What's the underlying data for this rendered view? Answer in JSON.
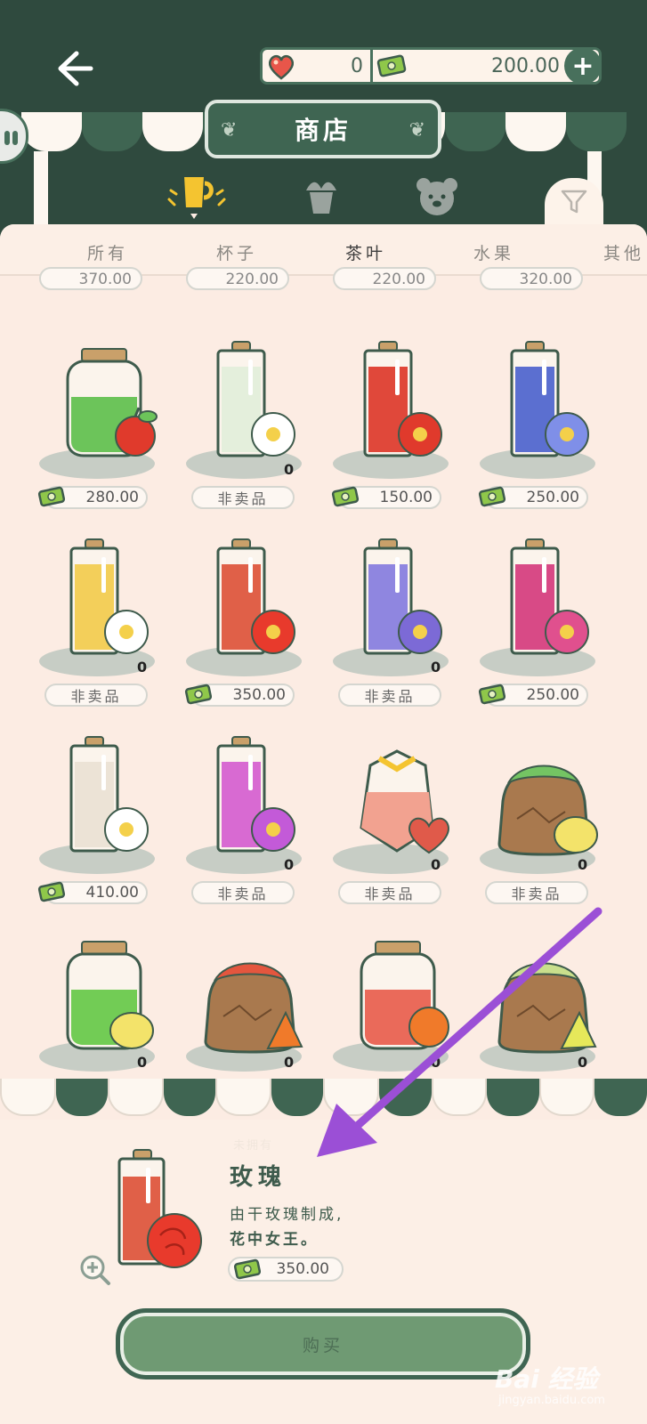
{
  "wallet": {
    "hearts": "0",
    "money": "200.00",
    "add": "+"
  },
  "title": "商店",
  "tabs": [
    "所有",
    "杯子",
    "茶叶",
    "水果",
    "其他"
  ],
  "active_tab": "茶叶",
  "partial_prices": [
    "370.00",
    "220.00",
    "220.00",
    "320.00"
  ],
  "items": [
    {
      "name": "jar-mint-apple",
      "price": "280.00",
      "sale": true,
      "count": "",
      "art": "jar",
      "liquid": "#6cc45a",
      "flower": "apple"
    },
    {
      "name": "tube-jasmine",
      "price": "非卖品",
      "sale": false,
      "count": "0",
      "art": "tube",
      "liquid": "#e4efdc",
      "flower": "#ffffff"
    },
    {
      "name": "tube-hibiscus",
      "price": "150.00",
      "sale": true,
      "count": "",
      "art": "tube",
      "liquid": "#e0483a",
      "flower": "#e03a2c"
    },
    {
      "name": "tube-blue-flower",
      "price": "250.00",
      "sale": true,
      "count": "",
      "art": "tube",
      "liquid": "#5b6fd0",
      "flower": "#7f8fe8"
    },
    {
      "name": "tube-chamomile",
      "price": "非卖品",
      "sale": false,
      "count": "0",
      "art": "tube",
      "liquid": "#f3cf5a",
      "flower": "#ffffff"
    },
    {
      "name": "tube-rose",
      "price": "350.00",
      "sale": true,
      "count": "",
      "art": "tube",
      "liquid": "#e06048",
      "flower": "#e83a2c"
    },
    {
      "name": "tube-lavender",
      "price": "非卖品",
      "sale": false,
      "count": "0",
      "art": "tube",
      "liquid": "#8f86e0",
      "flower": "#7c6ad6"
    },
    {
      "name": "tube-pink-flower",
      "price": "250.00",
      "sale": true,
      "count": "",
      "art": "tube",
      "liquid": "#d84a86",
      "flower": "#e0508e"
    },
    {
      "name": "tube-white-flower",
      "price": "410.00",
      "sale": true,
      "count": "",
      "art": "tube",
      "liquid": "#ece3d6",
      "flower": "#ffffff"
    },
    {
      "name": "tube-orchid",
      "price": "非卖品",
      "sale": false,
      "count": "0",
      "art": "tube",
      "liquid": "#d86ad2",
      "flower": "#c35ad8"
    },
    {
      "name": "heart-jar",
      "price": "非卖品",
      "sale": false,
      "count": "0",
      "art": "heartjar",
      "liquid": "#f2a290",
      "flower": "#e05a4a"
    },
    {
      "name": "sack-green-lemon",
      "price": "非卖品",
      "sale": false,
      "count": "0",
      "art": "sack",
      "liquid": "#74c463",
      "flower": "lemon"
    },
    {
      "name": "jar-green-lemon",
      "price": "非卖品",
      "sale": false,
      "count": "0",
      "art": "jar",
      "liquid": "#72cc55",
      "flower": "lemon"
    },
    {
      "name": "sack-red-orange",
      "price": "非卖品",
      "sale": false,
      "count": "0",
      "art": "sack",
      "liquid": "#e4563e",
      "flower": "#f07a2a"
    },
    {
      "name": "jar-red-orange",
      "price": "非卖品",
      "sale": false,
      "count": "0",
      "art": "jar",
      "liquid": "#ea6a5a",
      "flower": "#f07a2a"
    },
    {
      "name": "sack-yellow-green",
      "price": "非卖品",
      "sale": false,
      "count": "0",
      "art": "sack",
      "liquid": "#c9df8c",
      "flower": "#e6e85a"
    }
  ],
  "detail": {
    "tag": "未拥有",
    "name": "玫瑰",
    "desc1": "由干玫瑰制成,",
    "desc2": "花中女王。",
    "price": "350.00"
  },
  "buy_label": "购买",
  "watermark": "Bai 经验",
  "watermark_sub": "jingyan.baidu.com",
  "colors": {
    "dark_green": "#2f4a3e",
    "panel": "#fcece3",
    "accent_purple": "#9b4fd6",
    "cup_yellow": "#f4c430"
  }
}
